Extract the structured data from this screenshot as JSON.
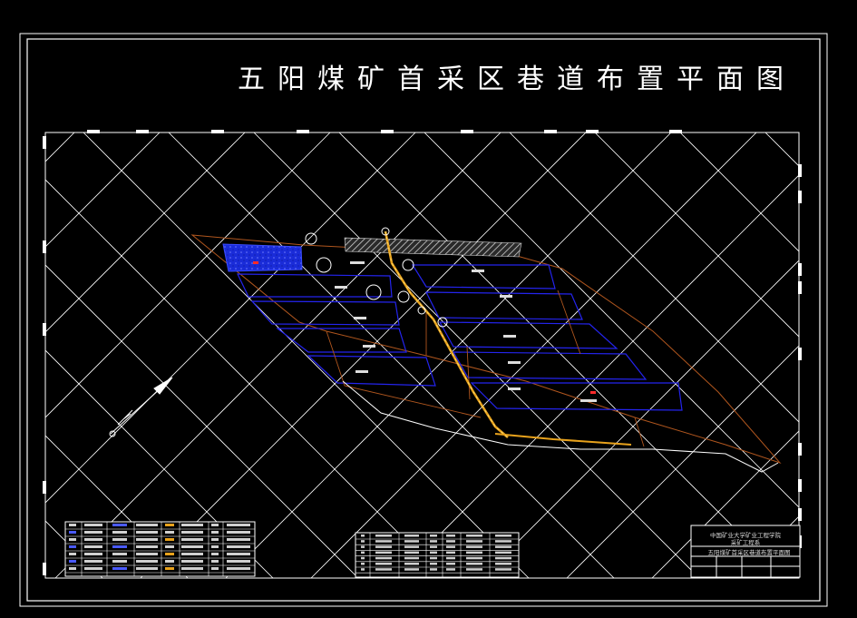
{
  "drawing": {
    "title": "五阳煤矿首采区巷道布置平面图",
    "title_block": {
      "line1": "中国矿业大学矿业工程学院",
      "line2": "采矿工程系",
      "drawing_name": "五阳煤矿首采区巷道布置平面图"
    }
  },
  "colors": {
    "background": "#000000",
    "frame": "#ffffff",
    "grid": "#ffffff",
    "roadway": "#e8a21c",
    "panel": "#1e1ee6",
    "boundary": "#b0561e",
    "goaf": "#1a2cd8",
    "marker": "#ff2a2a"
  }
}
